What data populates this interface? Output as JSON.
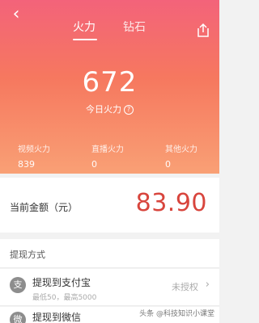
{
  "header": {
    "back_icon": "‹",
    "tabs": [
      {
        "label": "火力"
      },
      {
        "label": "钻石"
      }
    ],
    "share_icon": "share-icon"
  },
  "hero": {
    "value": "672",
    "label": "今日火力",
    "help_icon": "?",
    "stats": [
      {
        "label": "视频火力",
        "value": "839"
      },
      {
        "label": "直播火力",
        "value": "0"
      },
      {
        "label": "其他火力",
        "value": "0"
      }
    ]
  },
  "balance": {
    "label": "当前金额（元）",
    "value": "83.90"
  },
  "withdraw": {
    "section_title": "提现方式",
    "methods": [
      {
        "icon": "支",
        "title": "提现到支付宝",
        "subtitle": "最低50，最高5000",
        "status": "未授权",
        "chevron": "›"
      },
      {
        "icon": "微",
        "title": "提现到微信"
      }
    ]
  },
  "watermark": "头条 @科技知识小课堂"
}
